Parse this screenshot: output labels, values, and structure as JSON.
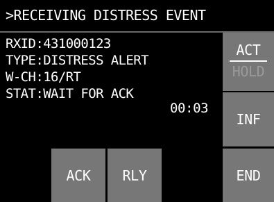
{
  "header": {
    "title": ">RECEIVING DISTRESS EVENT"
  },
  "info": {
    "rxid": "RXID:431000123",
    "type": "TYPE:DISTRESS ALERT",
    "wch": "W-CH:16/RT",
    "stat": "STAT:WAIT FOR ACK",
    "timer": "00:03"
  },
  "side_buttons": {
    "act": "ACT",
    "hold": "HOLD",
    "inf": "INF",
    "end": "END"
  },
  "bottom_buttons": {
    "ack": "ACK",
    "rly": "RLY"
  },
  "colors": {
    "background": "#000000",
    "button": "#777777",
    "text": "#ffffff",
    "disabled_text": "#9a9a9a"
  }
}
